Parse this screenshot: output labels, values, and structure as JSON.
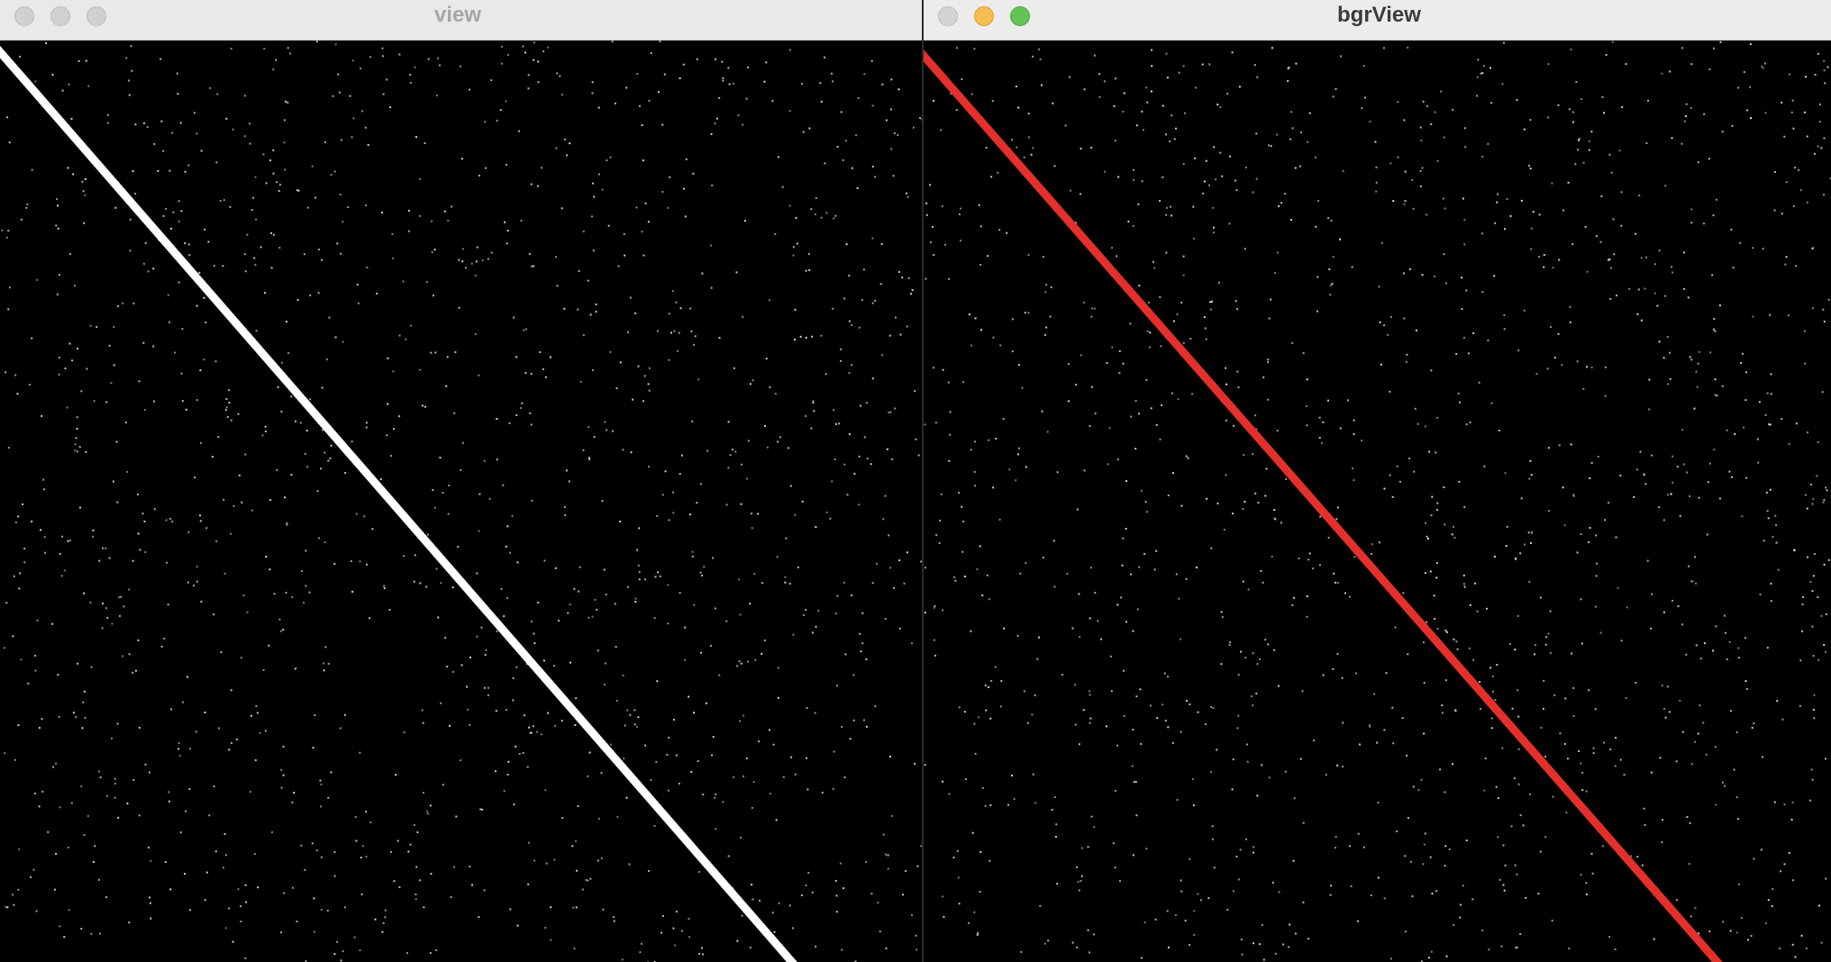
{
  "windows": [
    {
      "id": "view",
      "title": "view",
      "state": "inactive",
      "line_color": "#ffffff",
      "traffic_lights": [
        "close-icon",
        "minimize-icon",
        "zoom-icon"
      ]
    },
    {
      "id": "bgrView",
      "title": "bgrView",
      "state": "active",
      "line_color": "#e4302a",
      "traffic_lights": [
        "close-icon",
        "minimize-icon",
        "zoom-icon"
      ]
    }
  ],
  "colors": {
    "background": "#000000",
    "noise_dots": "#d8d8d8",
    "traffic_minimize": "#f5bd4f",
    "traffic_zoom": "#61c454"
  }
}
